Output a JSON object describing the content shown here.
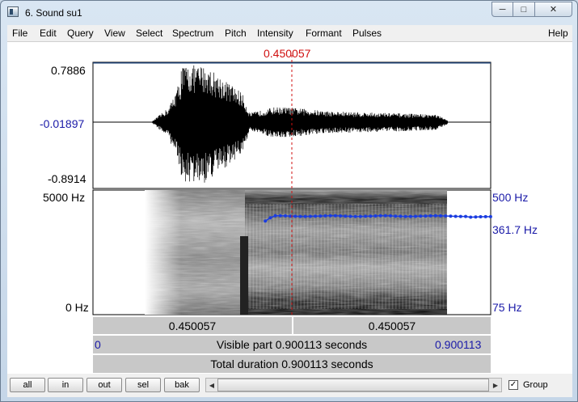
{
  "window": {
    "title": "6. Sound su1",
    "buttons": {
      "minimize": "minimize-icon",
      "maximize": "maximize-icon",
      "close": "close-icon"
    }
  },
  "menu": [
    "File",
    "Edit",
    "Query",
    "View",
    "Select",
    "Spectrum",
    "Pitch",
    "Intensity",
    "Formant",
    "Pulses"
  ],
  "help": "Help",
  "cursor_time": "0.450057",
  "waveform": {
    "max_label": "0.7886",
    "zero_label": "-0.01897",
    "min_label": "-0.8914"
  },
  "spectrogram": {
    "freq_top_label": "5000 Hz",
    "freq_bottom_label": "0 Hz",
    "pitch_top_label": "500 Hz",
    "pitch_value_label": "361.7 Hz",
    "pitch_bottom_label": "75 Hz",
    "pitch_track": {
      "start_time": 0.39,
      "end_time": 0.9,
      "value_hz": 361.7,
      "min_hz": 75,
      "max_hz": 500
    }
  },
  "time_row": {
    "left_value": "0.450057",
    "right_value": "0.450057"
  },
  "visible_row": {
    "start": "0",
    "text": "Visible part 0.900113 seconds",
    "end": "0.900113"
  },
  "total_row": {
    "text": "Total duration 0.900113 seconds"
  },
  "bottom": {
    "buttons": [
      "all",
      "in",
      "out",
      "sel",
      "bak"
    ],
    "group_label": "Group",
    "group_checked": "✓"
  },
  "colors": {
    "cursor": "#d01010",
    "pitch": "#1a3ce0",
    "label_blue": "#1a1aa8"
  }
}
